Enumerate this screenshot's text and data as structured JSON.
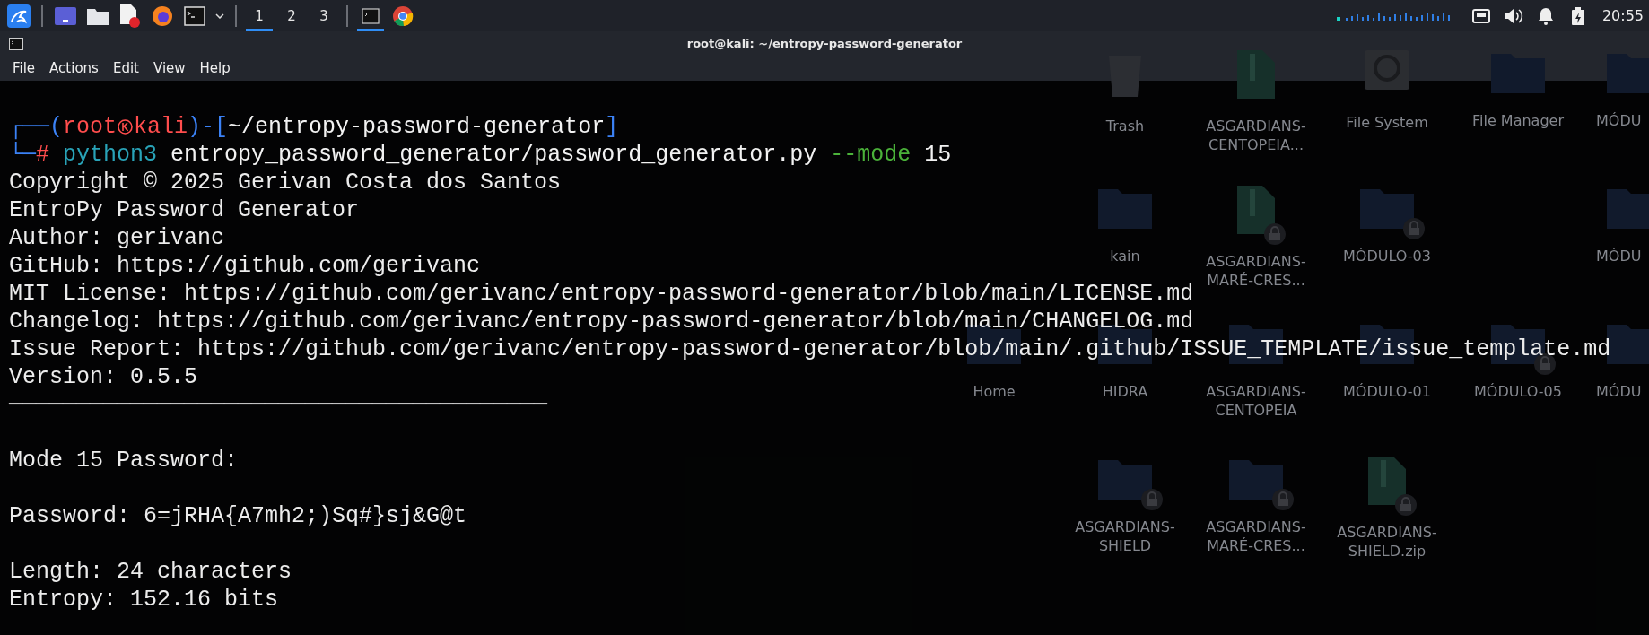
{
  "panel": {
    "workspaces": [
      {
        "label": "1",
        "selected": true
      },
      {
        "label": "2",
        "selected": false
      },
      {
        "label": "3",
        "selected": false
      }
    ],
    "clock": "20:55"
  },
  "desktop": {
    "rows": [
      {
        "icons": [
          {
            "kind": "blank"
          },
          {
            "label": "Trash",
            "kind": "trash",
            "locked": false
          },
          {
            "label": "ASGARDIANS-CENTOPEIA...",
            "kind": "archive",
            "locked": false
          },
          {
            "label": "File System",
            "kind": "drive",
            "locked": false
          },
          {
            "label": "File Manager",
            "kind": "folder",
            "locked": false
          },
          {
            "label": "MÓDU",
            "kind": "folder"
          }
        ]
      },
      {
        "icons": [
          {
            "kind": "blank"
          },
          {
            "label": "kain",
            "kind": "folder",
            "locked": false
          },
          {
            "label": "ASGARDIANS-MARÉ-CRES...",
            "kind": "archive",
            "locked": true
          },
          {
            "label": "MÓDULO-03",
            "kind": "folder",
            "locked": true
          },
          {
            "kind": "blank"
          },
          {
            "label": "MÓDU",
            "kind": "folder"
          }
        ]
      },
      {
        "icons": [
          {
            "label": "Home",
            "kind": "folder",
            "locked": false
          },
          {
            "label": "HIDRA",
            "kind": "folder",
            "locked": false
          },
          {
            "label": "ASGARDIANS-CENTOPEIA",
            "kind": "folder",
            "locked": false
          },
          {
            "label": "MÓDULO-01",
            "kind": "folder",
            "locked": false
          },
          {
            "label": "MÓDULO-05",
            "kind": "folder",
            "locked": true
          },
          {
            "label": "MÓDU",
            "kind": "folder"
          }
        ]
      },
      {
        "icons": [
          {
            "kind": "blank"
          },
          {
            "label": "ASGARDIANS-SHIELD",
            "kind": "folder",
            "locked": true
          },
          {
            "label": "ASGARDIANS-MARÉ-CRES...",
            "kind": "folder",
            "locked": true
          },
          {
            "label": "ASGARDIANS-SHIELD.zip",
            "kind": "archive",
            "locked": true
          }
        ]
      }
    ]
  },
  "terminal": {
    "title": "root@kali: ~/entropy-password-generator",
    "menu": [
      "File",
      "Actions",
      "Edit",
      "View",
      "Help"
    ],
    "prompt": {
      "open": "┌──(",
      "user": "root",
      "host": "kali",
      "mid": ")-[",
      "path": "~/entropy-password-generator",
      "close": "]",
      "corner": "└─",
      "marker": "#",
      "program": "python3",
      "script": "entropy_password_generator/password_generator.py",
      "flag": "--mode",
      "value": "15"
    },
    "output": [
      {
        "kind": "text",
        "text": "Copyright © 2025 Gerivan Costa dos Santos"
      },
      {
        "kind": "text",
        "text": "EntroPy Password Generator"
      },
      {
        "kind": "text",
        "text": "Author: gerivanc"
      },
      {
        "kind": "text",
        "text": "GitHub: https://github.com/gerivanc"
      },
      {
        "kind": "text",
        "text": "MIT License: https://github.com/gerivanc/entropy-password-generator/blob/main/LICENSE.md"
      },
      {
        "kind": "text",
        "text": "Changelog: https://github.com/gerivanc/entropy-password-generator/blob/main/CHANGELOG.md"
      },
      {
        "kind": "text",
        "text": "Issue Report: https://github.com/gerivanc/entropy-password-generator/blob/main/.github/ISSUE_TEMPLATE/issue_template.md"
      },
      {
        "kind": "text",
        "text": "Version: 0.5.5"
      },
      {
        "kind": "rule",
        "text": "────────────────────────────────────────"
      },
      {
        "kind": "gap"
      },
      {
        "kind": "text",
        "text": "Mode 15 Password:"
      },
      {
        "kind": "gap"
      },
      {
        "kind": "text",
        "text": "Password: 6=jRHA{A7mh2;)Sq#}sj&G@t"
      },
      {
        "kind": "gap"
      },
      {
        "kind": "text",
        "text": "Length: 24 characters"
      },
      {
        "kind": "text",
        "text": "Entropy: 152.16 bits"
      }
    ]
  }
}
